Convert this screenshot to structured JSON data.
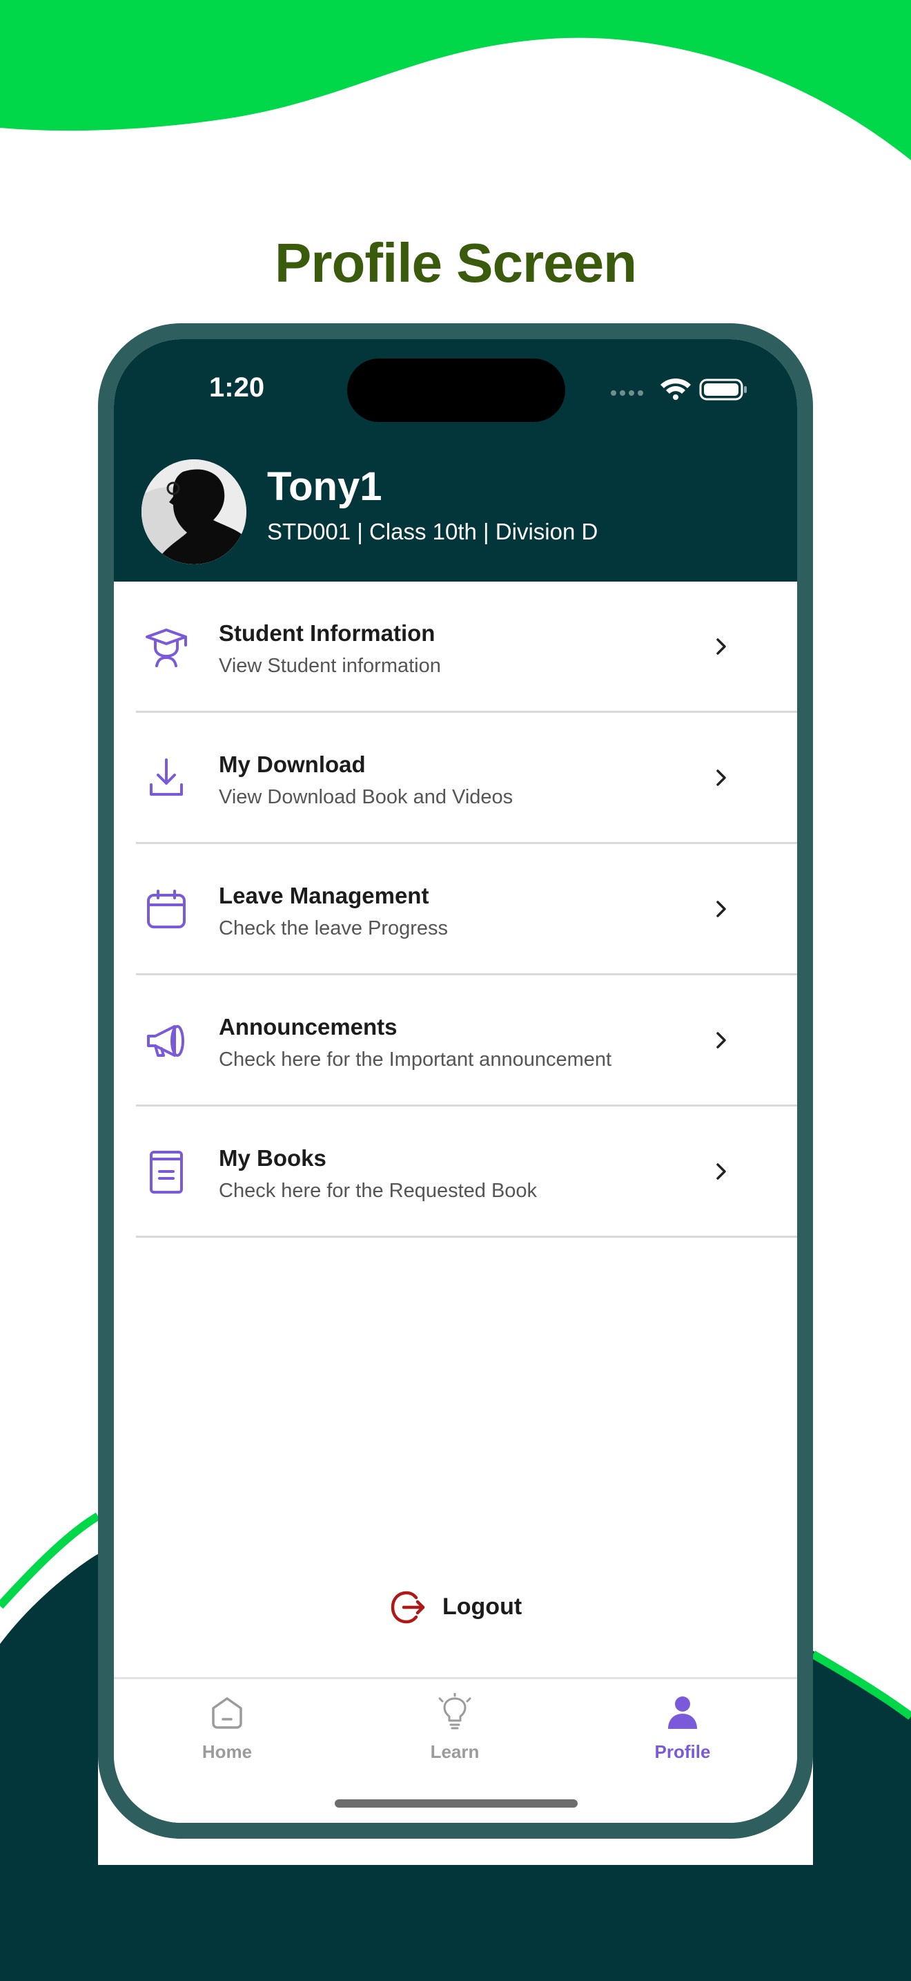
{
  "promo_title": "Profile Screen",
  "colors": {
    "brand_green": "#00d84a",
    "dark_teal": "#03363a",
    "phone_frame": "#2f5e5e",
    "title_green": "#3a5a0c",
    "accent_purple": "#7a5ad8",
    "logout_red": "#b01818"
  },
  "status_bar": {
    "time": "1:20"
  },
  "profile": {
    "name": "Tony1",
    "details": "STD001 | Class 10th | Division D"
  },
  "menu": {
    "items": [
      {
        "icon": "graduate-icon",
        "title": "Student Information",
        "description": "View Student information"
      },
      {
        "icon": "download-icon",
        "title": "My Download",
        "description": "View Download Book and Videos"
      },
      {
        "icon": "calendar-icon",
        "title": "Leave Management",
        "description": "Check the leave Progress"
      },
      {
        "icon": "megaphone-icon",
        "title": "Announcements",
        "description": "Check here for the Important announcement"
      },
      {
        "icon": "book-icon",
        "title": "My Books",
        "description": "Check here for the Requested Book"
      }
    ]
  },
  "logout": {
    "label": "Logout"
  },
  "tabbar": {
    "tabs": [
      {
        "label": "Home",
        "icon": "home-icon"
      },
      {
        "label": "Learn",
        "icon": "lightbulb-icon"
      },
      {
        "label": "Profile",
        "icon": "person-icon",
        "active": true
      }
    ]
  }
}
